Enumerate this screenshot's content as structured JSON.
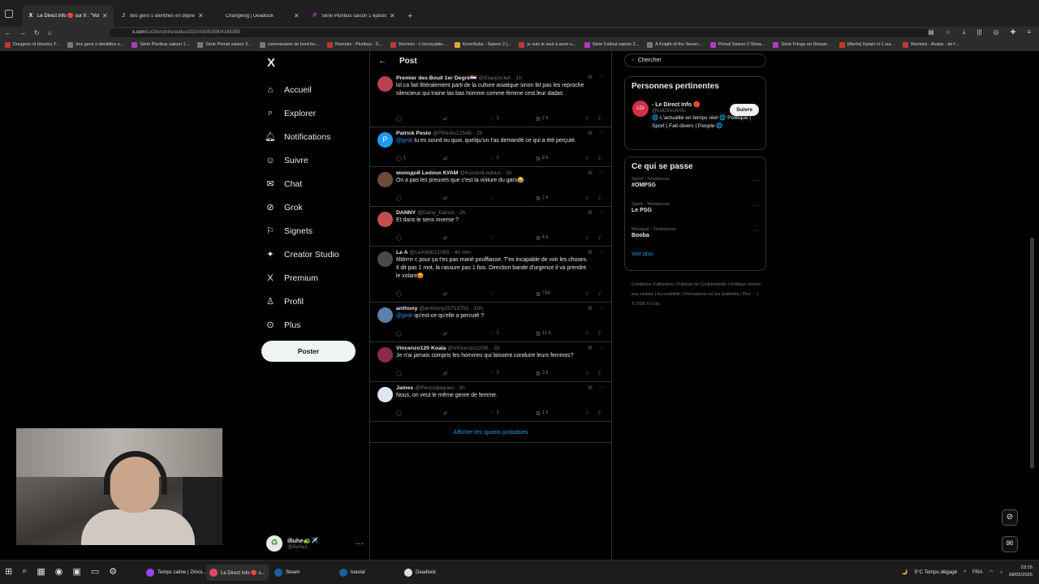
{
  "browser": {
    "tabs": [
      {
        "label": "Le Direct Info 🔴 sur X : \"Voilà",
        "active": true,
        "fav": "X"
      },
      {
        "label": "des gens s identifies en depress",
        "active": false,
        "fav": "J"
      },
      {
        "label": "Changelog | Deadlock",
        "active": false,
        "fav": ""
      },
      {
        "label": "Série Pluribus saison 1 épisode",
        "active": false,
        "fav": "P"
      }
    ],
    "url_domain": "x.com",
    "url_path": "/LeDirectInfo/status/2020430539904168399",
    "bookmarks": [
      "Dungeon ni Hisomu Y...",
      "des gens s identifies e...",
      "Série Pluribus saison 1...",
      "Série Primal saison 3...",
      "commissaire de bord bo...",
      "Remmix - Pluribus - S...",
      "Remmix - L'incroyable...",
      "KonoSuba - Saison 2 |...",
      "je suis le seul à avoir u...",
      "Série Fallout saison 2...",
      "A Knight of the Seven...",
      "Primal Saison 2 Strea...",
      "Série Fringe en Stream...",
      "[Alerte] Hytale H-1 sur...",
      "Remmix - Avatar : de f..."
    ]
  },
  "nav": {
    "logo": "X",
    "items": [
      {
        "label": "Accueil",
        "icon": "home-icon"
      },
      {
        "label": "Explorer",
        "icon": "search-icon"
      },
      {
        "label": "Notifications",
        "icon": "bell-icon"
      },
      {
        "label": "Suivre",
        "icon": "follow-icon"
      },
      {
        "label": "Chat",
        "icon": "mail-icon"
      },
      {
        "label": "Grok",
        "icon": "grok-icon"
      },
      {
        "label": "Signets",
        "icon": "bookmark-icon"
      },
      {
        "label": "Creator Studio",
        "icon": "creator-icon"
      },
      {
        "label": "Premium",
        "icon": "x-icon"
      },
      {
        "label": "Profil",
        "icon": "profile-icon"
      },
      {
        "label": "Plus",
        "icon": "more-icon"
      }
    ],
    "post_button": "Poster",
    "me_name": "illuhe🐢✈️",
    "me_handle": "@illuhe1"
  },
  "timeline": {
    "header": "Post",
    "replies": [
      {
        "name": "Premier des Boull 1er Degré🇳🇱",
        "handle": "@Elaepticlen",
        "time": "1h",
        "text": "lol ca fait littéralement parti de la culture asiatique sinon tkt pas les reproche silencieux qui traine las bas homme comme femme cest leur dadas",
        "mention": "",
        "replies": "",
        "likes": "1",
        "views": "2 k",
        "avatar_color": "#b9424f",
        "avatar_letter": ""
      },
      {
        "name": "Patrick Pesto",
        "handle": "@PPesto12546",
        "time": "2h",
        "text": "tu es sourd ou quoi, quelqu'un t'as demandé ce qui a été perçuté.",
        "mention": "@grok",
        "replies": "1",
        "likes": "1",
        "views": "8 k",
        "avatar_color": "#1d9bf0",
        "avatar_letter": "P"
      },
      {
        "name": "молодой Ledoux КУАМ",
        "handle": "@KouamLedoux",
        "time": "1h",
        "text": "On a pas les preuves que c'est la voiture du gars😂",
        "mention": "",
        "replies": "",
        "likes": "",
        "views": "2 k",
        "avatar_color": "#6b4a3a",
        "avatar_letter": ""
      },
      {
        "name": "DANNY",
        "handle": "@Dany_Danss",
        "time": "2h",
        "text": "Et dans le sens inverse ?",
        "mention": "",
        "replies": "",
        "likes": "",
        "views": "4 k",
        "avatar_color": "#c0504d",
        "avatar_letter": ""
      },
      {
        "name": "Le A",
        "handle": "@LeA69021085",
        "time": "40 min",
        "text": "Mdrrrrr c pour ça t'es pas marié pouffiasse. T'es incapable de voir les choses. Il dit pas 1 mot, la rassure pas 1 fois. Direction bande d'urgence il va prendre le volant😡",
        "mention": "",
        "replies": "",
        "likes": "",
        "views": "734",
        "avatar_color": "#4a4a4a",
        "avatar_letter": ""
      },
      {
        "name": "anthony",
        "handle": "@anthony25713751",
        "time": "10h",
        "text": "qu'est-ce qu'elle a percuté ?",
        "mention": "@grok",
        "replies": "",
        "likes": "1",
        "views": "11 k",
        "avatar_color": "#5a7fa8",
        "avatar_letter": ""
      },
      {
        "name": "Vincenzo120 Koala",
        "handle": "@Vincenzo120K",
        "time": "2h",
        "text": "Je n'ai jamais compris les hommes qui laissent conduire leurs femmes?",
        "mention": "",
        "replies": "",
        "likes": "1",
        "views": "3 k",
        "avatar_color": "#8a2b4a",
        "avatar_letter": ""
      },
      {
        "name": "James",
        "handle": "@Pierpoljaques",
        "time": "1h",
        "text": "Nous, on veut le même genre de femme.",
        "mention": "",
        "replies": "",
        "likes": "1",
        "views": "1 k",
        "avatar_color": "#dfe6ef",
        "avatar_letter": ""
      }
    ],
    "spam_link": "Afficher les spams probables"
  },
  "sidebar": {
    "search_placeholder": "Chercher",
    "relevant_title": "Personnes pertinentes",
    "relevant_name": "- Le Direct Info 🔴",
    "relevant_handle": "@LeDirectInfo",
    "relevant_bio": "🌐 L'actualité en temps réel 🌐 Politique | Sport | Fait divers | People 🌐",
    "follow_label": "Suivre",
    "trends_title": "Ce qui se passe",
    "trends": [
      {
        "category": "Sport · Tendances",
        "topic": "#OMPSG"
      },
      {
        "category": "Sport · Tendances",
        "topic": "Le PSG"
      },
      {
        "category": "Musique · Tendances",
        "topic": "Booba"
      }
    ],
    "see_more": "Voir plus",
    "footer": "Conditions d'utilisation | Politique de Confidentialité | Politique relative aux cookies | Accessibilité | Informations sur les publicités | Plus ··· | © 2026 X Corp."
  },
  "taskbar": {
    "apps": [
      {
        "label": "Temps calme | Zimoi...",
        "color": "#9146ff",
        "active": false
      },
      {
        "label": "Le Direct Info 🔴 s...",
        "color": "#e04a6c",
        "active": true
      },
      {
        "label": "Steam",
        "color": "#1b5f9e",
        "active": false
      },
      {
        "label": "toastal",
        "color": "#1b5f9e",
        "active": false
      },
      {
        "label": "Deadlock",
        "color": "#dddddd",
        "active": false
      }
    ],
    "weather": "5°C  Temps dégagé",
    "lang": "FRA",
    "time": "23:15",
    "date": "08/02/2026"
  }
}
